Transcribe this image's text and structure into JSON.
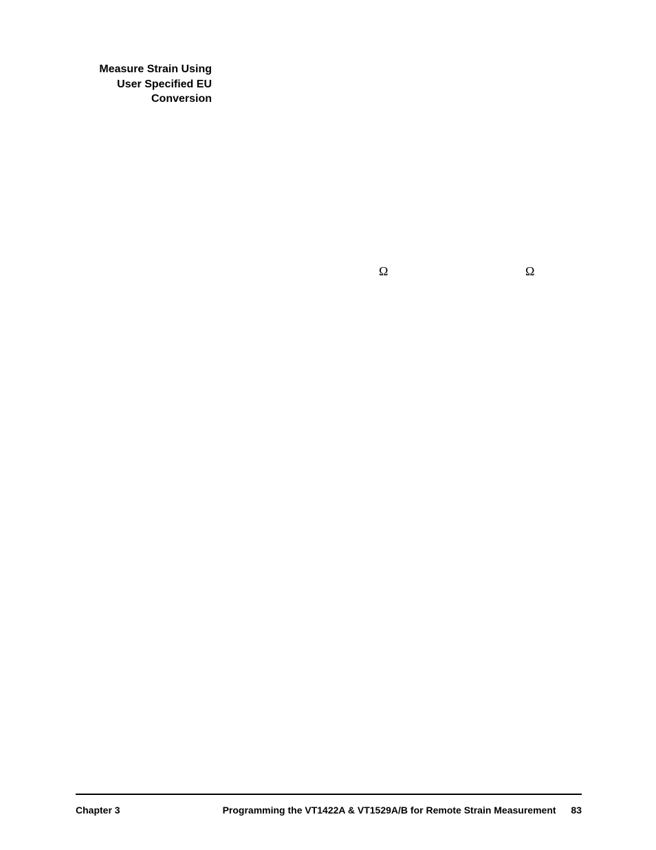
{
  "sideHeading": {
    "line1": "Measure Strain Using",
    "line2": "User Specified EU",
    "line3": "Conversion"
  },
  "symbols": {
    "omega": "Ω"
  },
  "footer": {
    "chapter": "Chapter 3",
    "title": "Programming the VT1422A & VT1529A/B for Remote Strain Measurement",
    "page": "83"
  }
}
